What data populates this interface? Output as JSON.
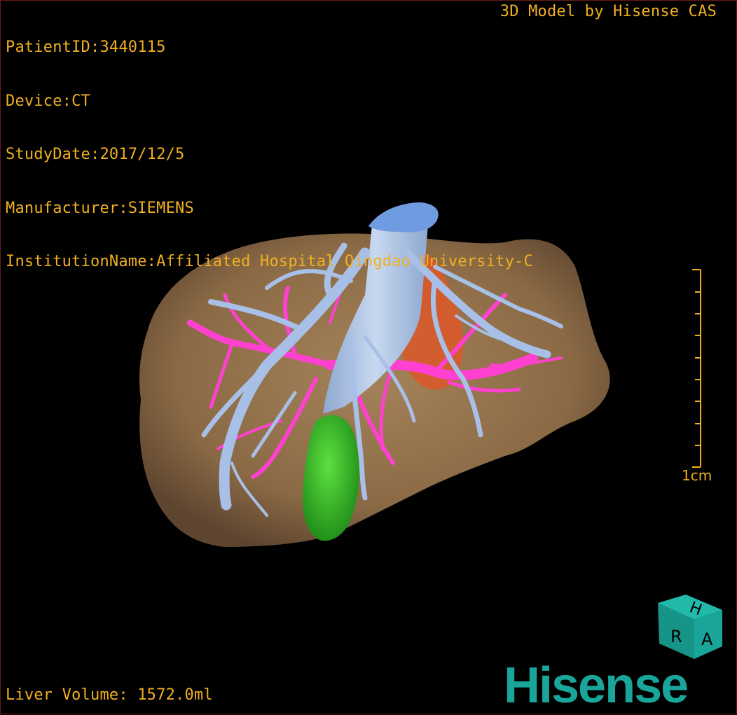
{
  "info": {
    "patient_id": "PatientID:3440115",
    "device": "Device:CT",
    "study_date": "StudyDate:2017/12/5",
    "manufacturer": "Manufacturer:SIEMENS",
    "institution": "InstitutionName:Affiliated Hospital Qingdao University-C"
  },
  "credit": "3D Model by Hisense CAS",
  "volume": "Liver Volume: 1572.0ml",
  "scale": {
    "label": "1cm",
    "color": "#f0b020"
  },
  "orientation_cube": {
    "faces": [
      "H",
      "R",
      "A"
    ],
    "color": "#1aa59a"
  },
  "logo": {
    "text": "Hisense",
    "color": "#1aa59a"
  },
  "colors": {
    "liver": "#8a6a45",
    "hepatic_vein": "#a8c0e8",
    "portal_vein": "#ff40d0",
    "gallbladder": "#3cc020",
    "vena_cava_top": "#6090e0",
    "orange_structure": "#e06030"
  }
}
